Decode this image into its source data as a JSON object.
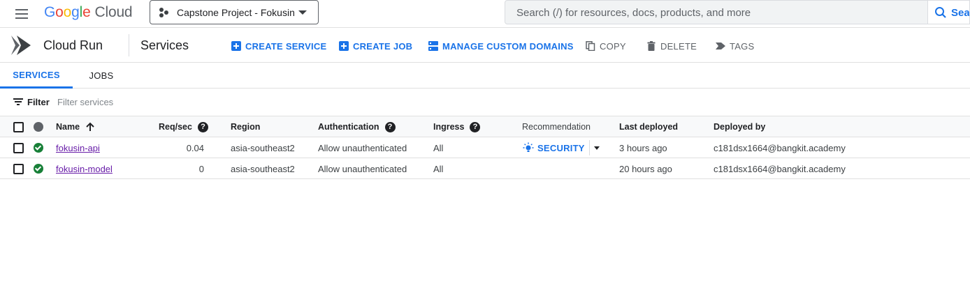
{
  "topbar": {
    "menu_icon": "hamburger-menu-icon",
    "logo": {
      "google": [
        "G",
        "o",
        "o",
        "g",
        "l",
        "e"
      ],
      "cloud": "Cloud"
    },
    "project": "Capstone Project - Fokusin",
    "search_placeholder": "Search (/) for resources, docs, products, and more",
    "search_button": "Sear"
  },
  "product": {
    "name": "Cloud Run",
    "page_title": "Services",
    "actions": {
      "create_service": "CREATE SERVICE",
      "create_job": "CREATE JOB",
      "manage_domains": "MANAGE CUSTOM DOMAINS",
      "copy": "COPY",
      "delete": "DELETE",
      "tags": "TAGS"
    }
  },
  "tabs": [
    {
      "label": "SERVICES",
      "active": true
    },
    {
      "label": "JOBS",
      "active": false
    }
  ],
  "filter": {
    "label": "Filter",
    "placeholder": "Filter services"
  },
  "table": {
    "columns": {
      "name": "Name",
      "req": "Req/sec",
      "region": "Region",
      "auth": "Authentication",
      "ingress": "Ingress",
      "recommendation": "Recommendation",
      "last_deployed": "Last deployed",
      "deployed_by": "Deployed by"
    },
    "help_glyph": "?",
    "rows": [
      {
        "name": "fokusin-api",
        "req": "0.04",
        "region": "asia-southeast2",
        "auth": "Allow unauthenticated",
        "ingress": "All",
        "recommendation": "SECURITY",
        "last_deployed": "3 hours ago",
        "deployed_by": "c181dsx1664@bangkit.academy"
      },
      {
        "name": "fokusin-model",
        "req": "0",
        "region": "asia-southeast2",
        "auth": "Allow unauthenticated",
        "ingress": "All",
        "recommendation": "",
        "last_deployed": "20 hours ago",
        "deployed_by": "c181dsx1664@bangkit.academy"
      }
    ]
  },
  "colors": {
    "accent": "#1a73e8",
    "success": "#188038",
    "visited_link": "#681da8"
  }
}
